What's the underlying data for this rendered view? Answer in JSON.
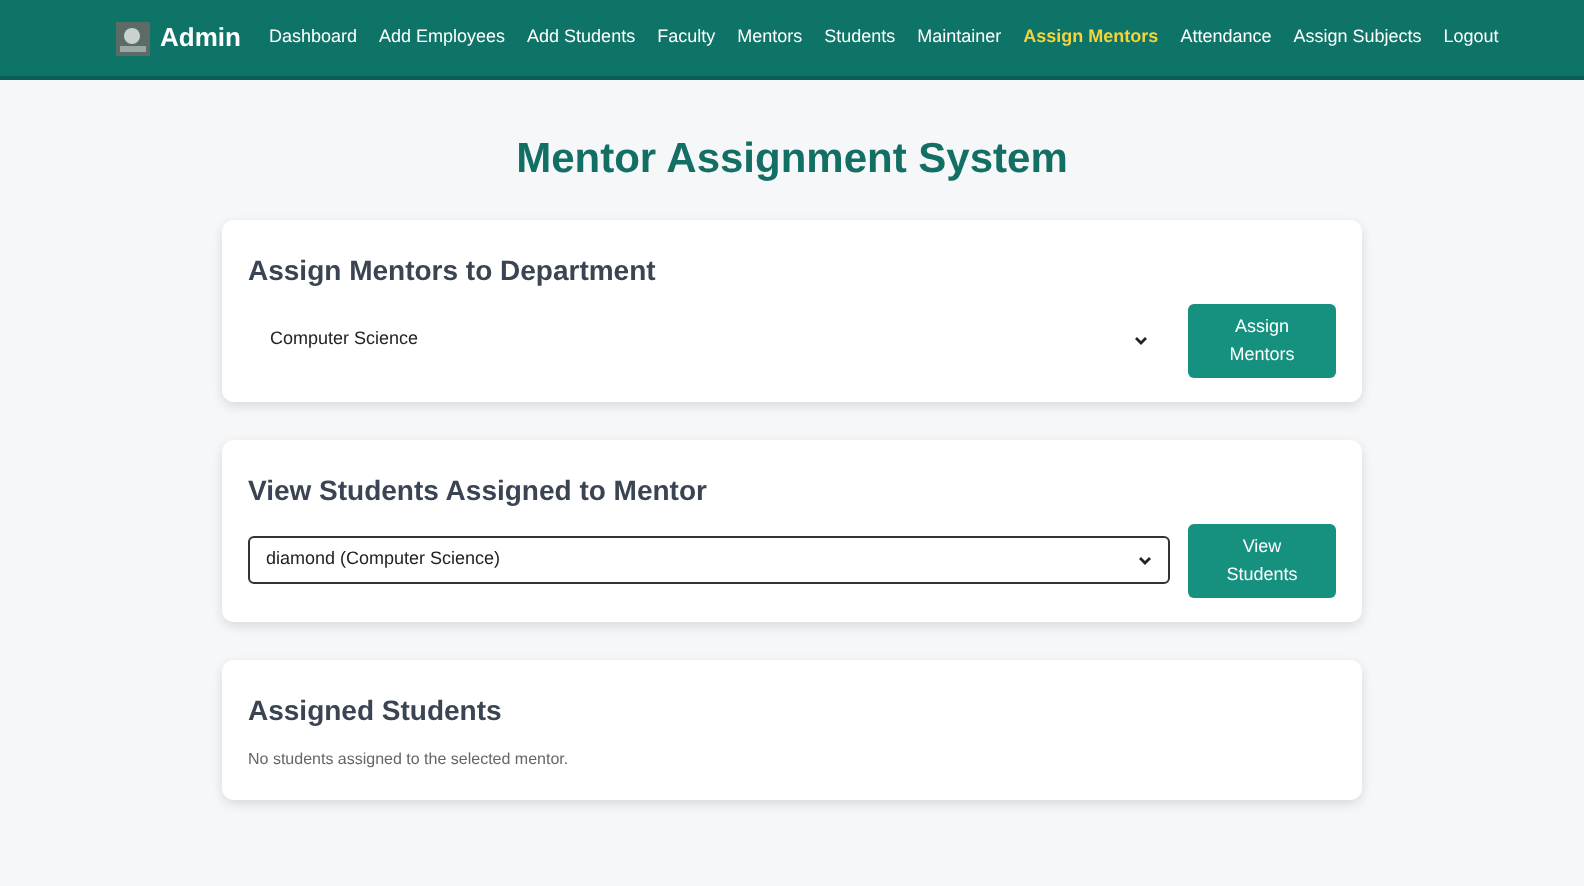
{
  "navbar": {
    "brand": "Admin",
    "items": [
      {
        "label": "Dashboard",
        "selected": false
      },
      {
        "label": "Add Employees",
        "selected": false
      },
      {
        "label": "Add Students",
        "selected": false
      },
      {
        "label": "Faculty",
        "selected": false
      },
      {
        "label": "Mentors",
        "selected": false
      },
      {
        "label": "Students",
        "selected": false
      },
      {
        "label": "Maintainer",
        "selected": false
      },
      {
        "label": "Assign Mentors",
        "selected": true
      },
      {
        "label": "Attendance",
        "selected": false
      },
      {
        "label": "Assign Subjects",
        "selected": false
      },
      {
        "label": "Logout",
        "selected": false
      }
    ]
  },
  "page_title": "Mentor Assignment System",
  "cards": [
    {
      "kind": "form",
      "title": "Assign Mentors to Department",
      "select": {
        "value": "Computer Science",
        "focused": false
      },
      "button": [
        "Assign",
        "Mentors"
      ]
    },
    {
      "kind": "form",
      "title": "View Students Assigned to Mentor",
      "select": {
        "value": "diamond (Computer Science)",
        "focused": true
      },
      "button": [
        "View",
        "Students"
      ]
    },
    {
      "kind": "message",
      "title": "Assigned Students",
      "message": "No students assigned to the selected mentor."
    }
  ]
}
